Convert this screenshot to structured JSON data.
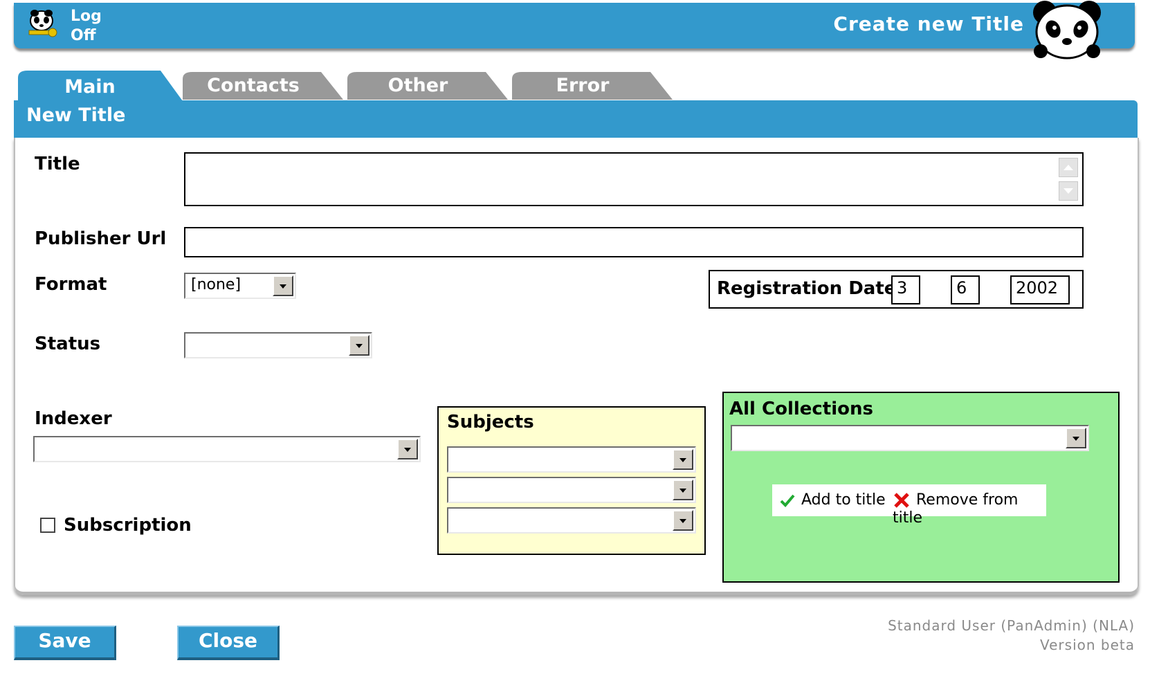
{
  "header": {
    "logoff_line1": "Log",
    "logoff_line2": "Off",
    "title": "Create new Title"
  },
  "tabs": [
    {
      "label": "Main",
      "active": true
    },
    {
      "label": "Contacts",
      "active": false
    },
    {
      "label": "Other",
      "active": false
    },
    {
      "label": "Error",
      "active": false
    }
  ],
  "panel": {
    "title": "New Title"
  },
  "form": {
    "title_label": "Title",
    "title_value": "",
    "publisher_url_label": "Publisher Url",
    "publisher_url_value": "",
    "format_label": "Format",
    "format_value": "[none]",
    "status_label": "Status",
    "status_value": "",
    "registration_date_label": "Registration Date",
    "reg_day": "3",
    "reg_month": "6",
    "reg_year": "2002",
    "indexer_label": "Indexer",
    "indexer_value": "",
    "subscription_label": "Subscription",
    "subscription_checked": false
  },
  "subjects": {
    "label": "Subjects",
    "values": [
      "",
      "",
      ""
    ]
  },
  "collections": {
    "label": "All Collections",
    "value": "",
    "add_label": "Add to title",
    "remove_label": "Remove from title"
  },
  "buttons": {
    "save": "Save",
    "close": "Close"
  },
  "footer": {
    "user": "Standard User (PanAdmin) (NLA)",
    "version": "Version beta"
  },
  "colors": {
    "brand_blue": "#3399cc",
    "tab_gray": "#999999",
    "subjects_bg": "#ffffd0",
    "collections_bg": "#99ee99"
  }
}
